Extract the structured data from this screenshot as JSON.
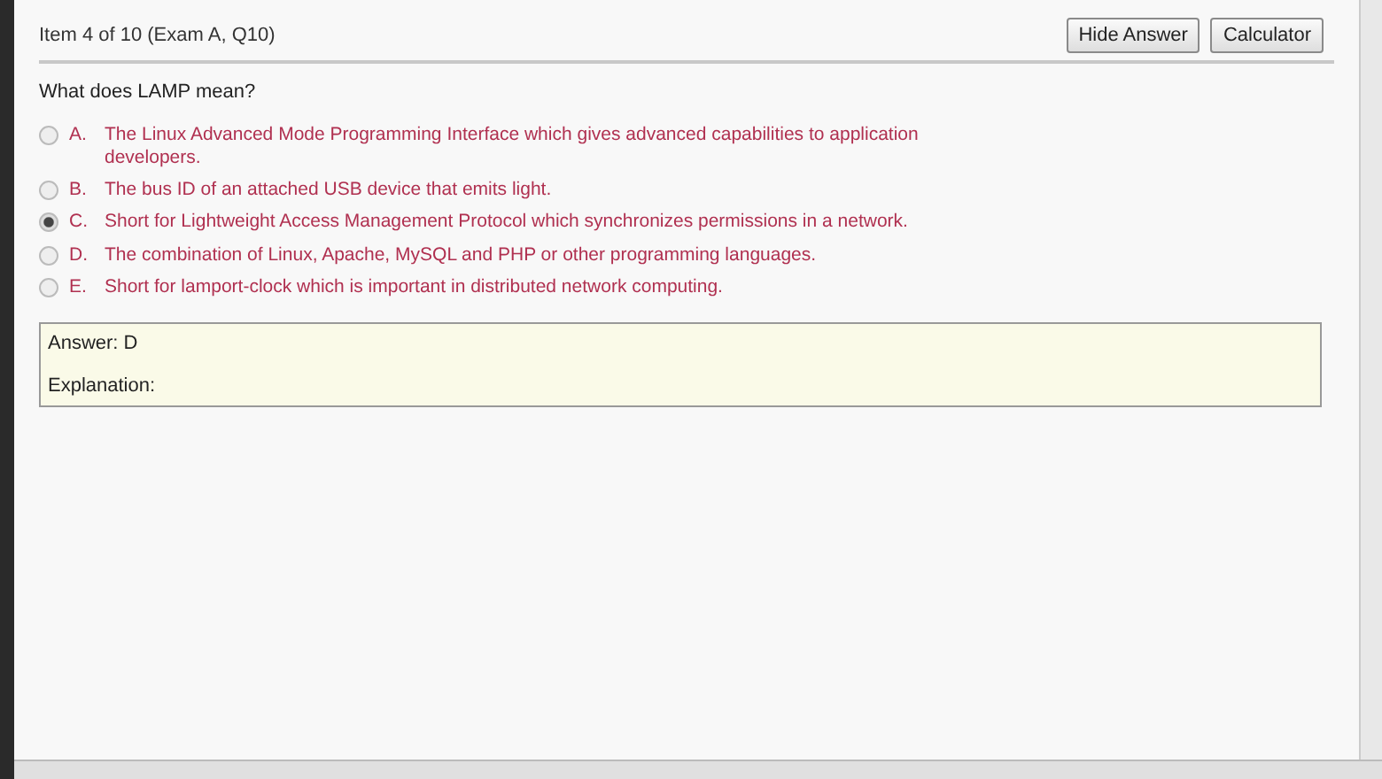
{
  "header": {
    "title": "Item 4 of 10  (Exam A, Q10)",
    "buttons": [
      "Hide Answer",
      "Calculator"
    ]
  },
  "question": "What does LAMP mean?",
  "options": [
    {
      "letter": "A.",
      "text": "The Linux Advanced Mode Programming Interface which gives advanced capabilities to application developers.",
      "selected": false
    },
    {
      "letter": "B.",
      "text": "The bus ID of an attached USB device that emits light.",
      "selected": false
    },
    {
      "letter": "C.",
      "text": "Short for Lightweight Access Management Protocol which synchronizes permissions in a network.",
      "selected": true
    },
    {
      "letter": "D.",
      "text": "The combination of Linux, Apache, MySQL and PHP or other programming languages.",
      "selected": false
    },
    {
      "letter": "E.",
      "text": "Short for lamport-clock which is important in distributed network computing.",
      "selected": false
    }
  ],
  "answer": {
    "answer_line": "Answer: D",
    "explanation": "Explanation:"
  }
}
